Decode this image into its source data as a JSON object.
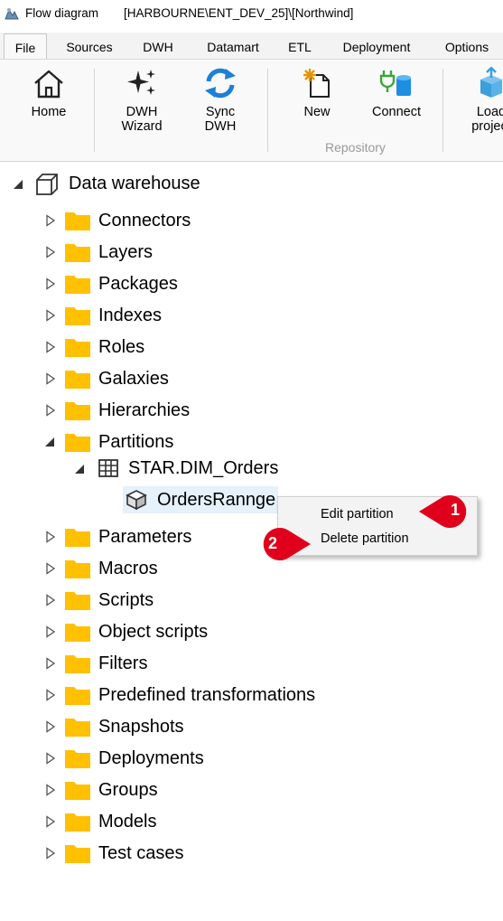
{
  "window": {
    "app_title": "Flow diagram",
    "connection": "[HARBOURNE\\ENT_DEV_25]\\[Northwind]"
  },
  "tabs": [
    "File",
    "Sources",
    "DWH",
    "Datamart",
    "ETL",
    "Deployment",
    "Options"
  ],
  "active_tab": "File",
  "ribbon": {
    "home": "Home",
    "dwh_wizard_line1": "DWH",
    "dwh_wizard_line2": "Wizard",
    "sync_dwh_line1": "Sync",
    "sync_dwh_line2": "DWH",
    "new": "New",
    "connect": "Connect",
    "load_project_line1": "Load",
    "load_project_line2": "project",
    "group_repository": "Repository"
  },
  "tree": {
    "root": "Data warehouse",
    "items": [
      "Connectors",
      "Layers",
      "Packages",
      "Indexes",
      "Roles",
      "Galaxies",
      "Hierarchies",
      "Partitions"
    ],
    "partition_table": "STAR.DIM_Orders",
    "partition_item": "OrdersRannge",
    "items_after": [
      "Parameters",
      "Macros",
      "Scripts",
      "Object scripts",
      "Filters",
      "Predefined transformations",
      "Snapshots",
      "Deployments",
      "Groups",
      "Models",
      "Test cases"
    ]
  },
  "context_menu": {
    "edit": "Edit partition",
    "delete": "Delete partition"
  },
  "callouts": [
    "1",
    "2"
  ],
  "colors": {
    "folder": "#ffc000",
    "callout_red": "#e0001b",
    "sync_blue": "#1e7fd6",
    "connect_green": "#3aa63a"
  }
}
